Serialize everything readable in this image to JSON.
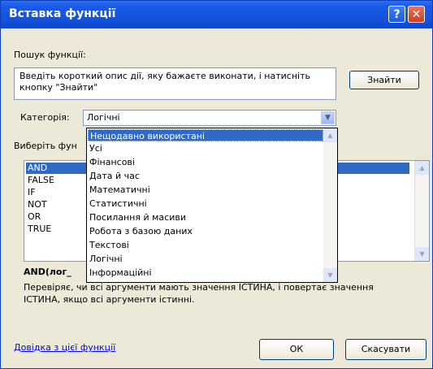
{
  "window": {
    "title": "Вставка функції"
  },
  "search": {
    "label": "Пошук функції:",
    "text": "Введіть короткий опис дії, яку бажаєте виконати, і натисніть кнопку \"Знайти\"",
    "button": "Знайти"
  },
  "category": {
    "label": "Категорія:",
    "value": "Логічні",
    "options": [
      "Нещодавно використані",
      "Усі",
      "Фінансові",
      "Дата й час",
      "Математичні",
      "Статистичні",
      "Посилання й масиви",
      "Робота з базою даних",
      "Текстові",
      "Логічні",
      "Інформаційні"
    ],
    "highlighted": "Нещодавно використані"
  },
  "functions": {
    "label": "Виберіть фун",
    "items": [
      "AND",
      "FALSE",
      "IF",
      "NOT",
      "OR",
      "TRUE"
    ],
    "selected": "AND"
  },
  "details": {
    "signature": "AND(лог_",
    "description": "Перевіряє, чи всі аргументи мають значення ІСТИНА, і повертає значення ІСТИНА, якщо всі аргументи істинні."
  },
  "footer": {
    "help_link": "Довідка з цієї функції",
    "ok": "ОК",
    "cancel": "Скасувати"
  }
}
